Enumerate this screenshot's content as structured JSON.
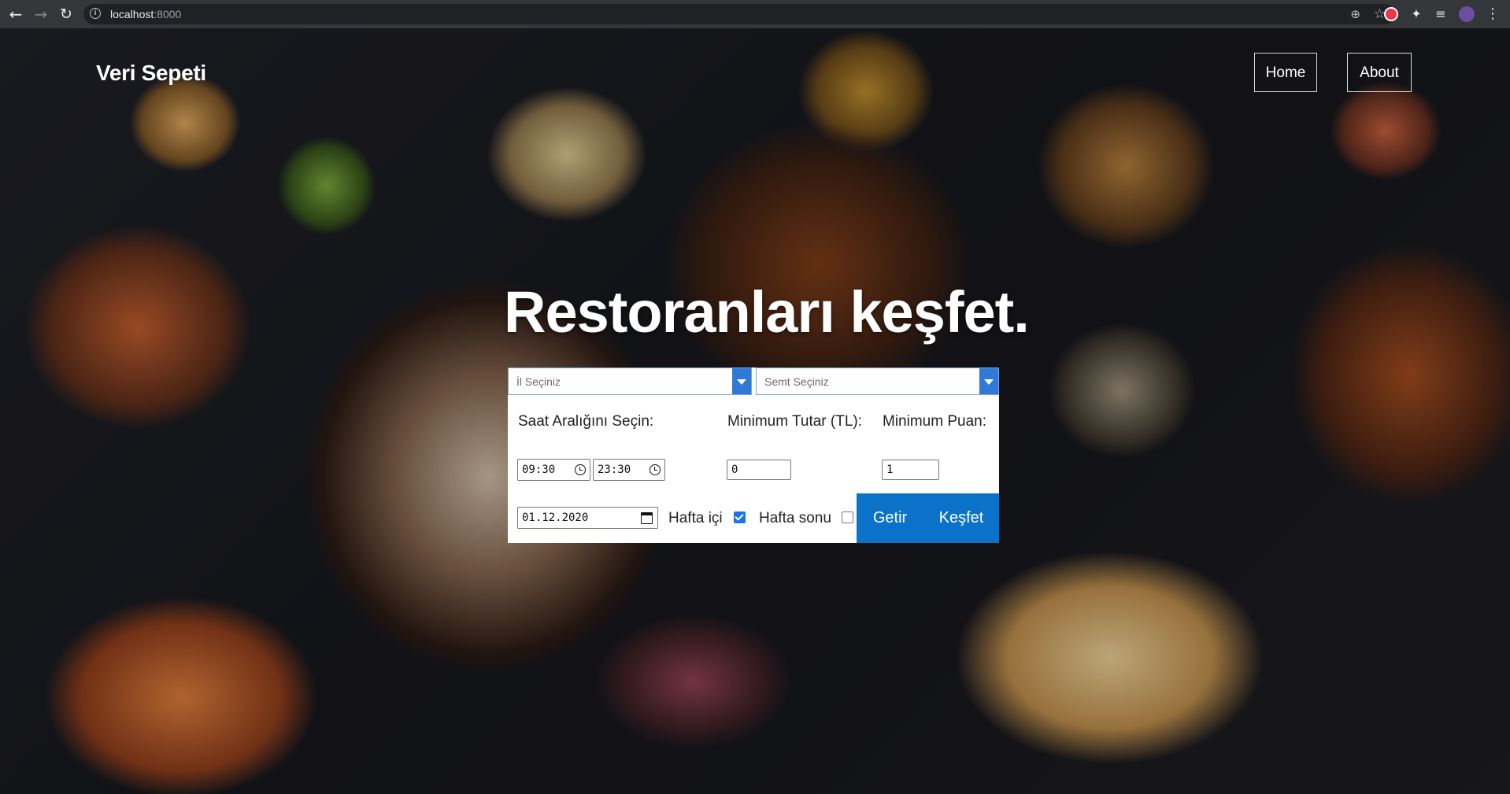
{
  "browser": {
    "url_host": "localhost",
    "url_port": ":8000"
  },
  "site": {
    "brand": "Veri Sepeti",
    "nav": [
      "Home",
      "About"
    ],
    "headline": "Restoranları keşfet."
  },
  "form": {
    "city_placeholder": "İl Seçiniz",
    "district_placeholder": "Semt Seçiniz",
    "time_label": "Saat Aralığını Seçin:",
    "min_amount_label": "Minimum Tutar (TL):",
    "min_rating_label": "Minimum Puan:",
    "time_start": "09:30",
    "time_end": "23:30",
    "min_amount": "0",
    "min_rating": "1",
    "date": "01.12.2020",
    "weekday_label": "Hafta içi",
    "weekday_checked": true,
    "weekend_label": "Hafta sonu",
    "weekend_checked": false,
    "fetch_button": "Getir",
    "explore_button": "Keşfet"
  },
  "colors": {
    "button": "#0a72c9",
    "select_arrow": "#2f7ad6"
  }
}
